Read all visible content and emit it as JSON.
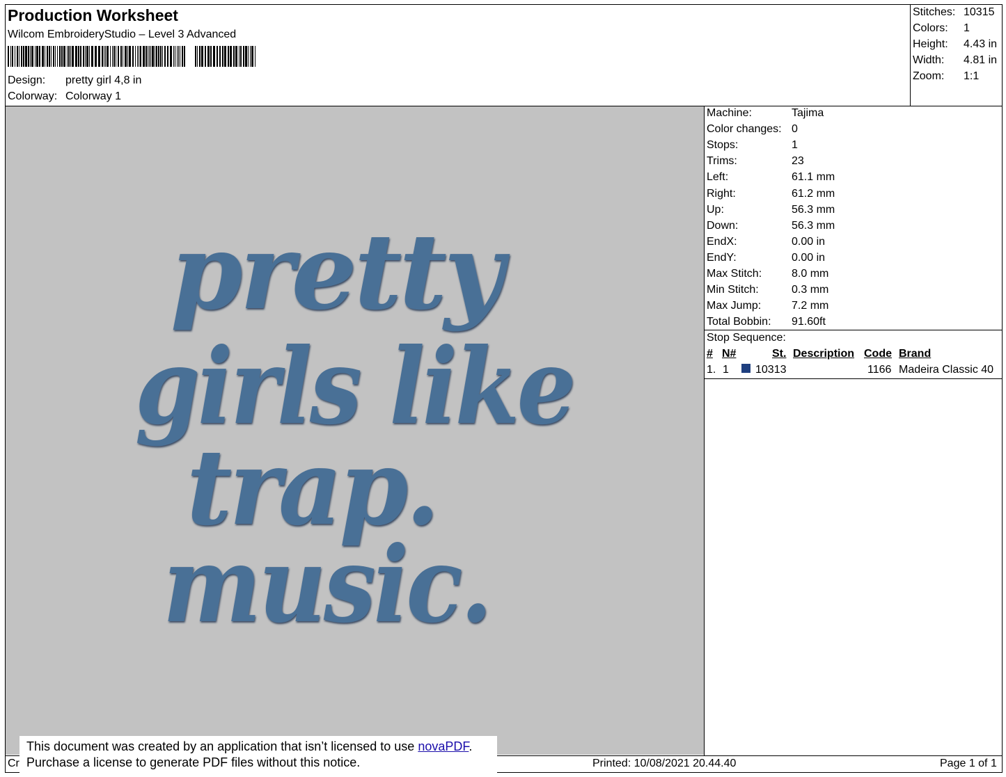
{
  "header": {
    "title": "Production Worksheet",
    "subtitle": "Wilcom EmbroideryStudio – Level 3 Advanced",
    "design_label": "Design:",
    "design_value": "pretty girl 4,8 in",
    "colorway_label": "Colorway:",
    "colorway_value": "Colorway 1"
  },
  "stats": [
    {
      "label": "Stitches:",
      "value": "10315"
    },
    {
      "label": "Colors:",
      "value": "1"
    },
    {
      "label": "Height:",
      "value": "4.43 in"
    },
    {
      "label": "Width:",
      "value": "4.81 in"
    },
    {
      "label": "Zoom:",
      "value": "1:1"
    }
  ],
  "design_preview": {
    "lines": [
      "pretty",
      "girls like",
      "trap.",
      "music."
    ],
    "thread_color": "#4a6f96"
  },
  "machine_info": [
    {
      "label": "Machine:",
      "value": "Tajima"
    },
    {
      "label": "Color changes:",
      "value": "0"
    },
    {
      "label": "Stops:",
      "value": "1"
    },
    {
      "label": "Trims:",
      "value": "23"
    },
    {
      "label": "Left:",
      "value": "61.1 mm"
    },
    {
      "label": "Right:",
      "value": "61.2 mm"
    },
    {
      "label": "Up:",
      "value": "56.3 mm"
    },
    {
      "label": "Down:",
      "value": "56.3 mm"
    },
    {
      "label": "EndX:",
      "value": "0.00 in"
    },
    {
      "label": "EndY:",
      "value": "0.00 in"
    },
    {
      "label": "Max Stitch:",
      "value": "8.0 mm"
    },
    {
      "label": "Min Stitch:",
      "value": "0.3 mm"
    },
    {
      "label": "Max Jump:",
      "value": "7.2 mm"
    },
    {
      "label": "Total Bobbin:",
      "value": "91.60ft"
    }
  ],
  "stop_sequence": {
    "label": "Stop Sequence:",
    "columns": [
      "#",
      "N#",
      "St.",
      "Description",
      "Code",
      "Brand"
    ],
    "rows": [
      {
        "num": "1.",
        "n": "1",
        "swatch_color": "#1f3f7f",
        "stitches": "10313",
        "description": "",
        "code": "1166",
        "brand": "Madeira Classic 40"
      }
    ]
  },
  "footer": {
    "left_fragment": "Cr",
    "printed": "Printed: 10/08/2021 20.44.40",
    "page": "Page 1 of 1"
  },
  "notice": {
    "line1_prefix": "This document was created by an application that isn’t licensed to use ",
    "link": "novaPDF",
    "line1_suffix": ".",
    "line2": "Purchase a license to generate PDF files without this notice."
  }
}
